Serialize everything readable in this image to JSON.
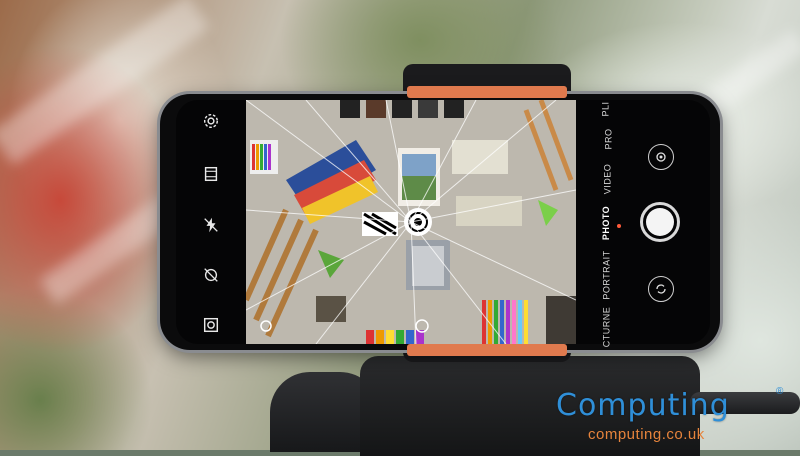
{
  "camera_app": {
    "left_controls": [
      "settings-icon",
      "video-ratio-icon",
      "flash-off-icon",
      "ai-off-icon",
      "filter-icon"
    ],
    "modes": {
      "partial_top": "PLI",
      "pro": "PRO",
      "video": "VIDEO",
      "photo": "PHOTO",
      "portrait": "PORTRAIT",
      "partial_bottom": "CTURNE"
    },
    "active_mode": "PHOTO",
    "right_buttons": [
      "switch-camera-icon",
      "gallery-thumbnail-icon"
    ]
  },
  "watermark": {
    "title": "Computing",
    "subtitle": "computing.co.uk",
    "registered": "®",
    "title_color": "#2f8fd8",
    "subtitle_color": "#e7843c"
  }
}
